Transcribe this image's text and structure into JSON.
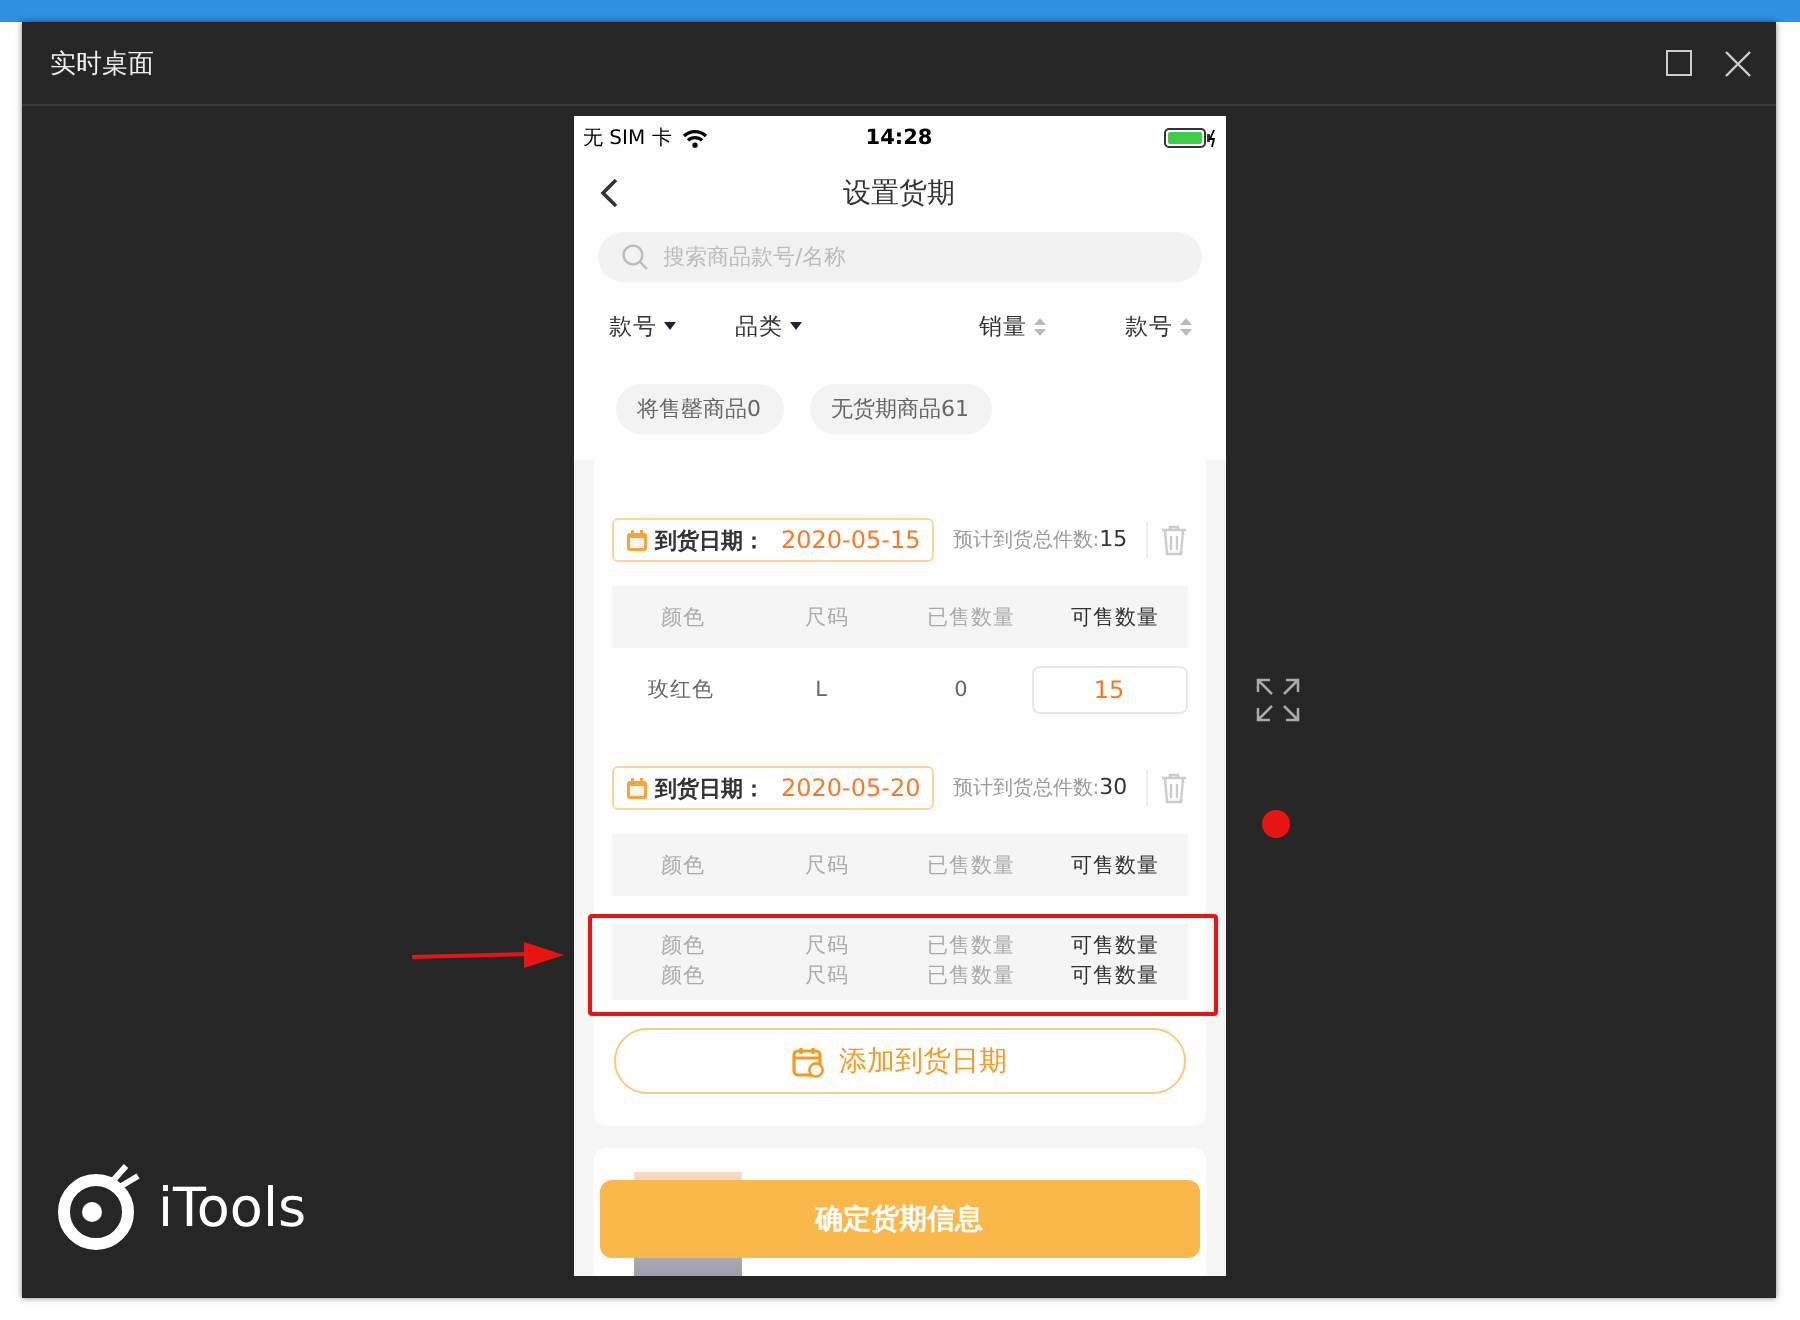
{
  "window": {
    "title": "实时桌面"
  },
  "phone": {
    "status_bar": {
      "carrier": "无 SIM 卡",
      "time": "14:28"
    },
    "nav": {
      "title": "设置货期"
    },
    "search": {
      "placeholder": "搜索商品款号/名称"
    },
    "filters": [
      {
        "label": "款号",
        "kind": "dropdown"
      },
      {
        "label": "品类",
        "kind": "dropdown"
      },
      {
        "label": "销量",
        "kind": "sort"
      },
      {
        "label": "款号",
        "kind": "sort"
      }
    ],
    "chips": [
      "将售罄商品0",
      "无货期商品61"
    ],
    "batches": [
      {
        "date_label": "到货日期：",
        "date": "2020-05-15",
        "total_label": "预计到货总件数:",
        "total": "15",
        "columns": [
          "颜色",
          "尺码",
          "已售数量",
          "可售数量"
        ],
        "rows": [
          [
            "玫红色",
            "L",
            "0",
            "15"
          ]
        ]
      },
      {
        "date_label": "到货日期：",
        "date": "2020-05-20",
        "total_label": "预计到货总件数:",
        "total": "30",
        "columns": [
          "颜色",
          "尺码",
          "已售数量",
          "可售数量"
        ]
      }
    ],
    "overlapping_headers": [
      [
        "颜色",
        "尺码",
        "已售数量",
        "可售数量"
      ],
      [
        "颜色",
        "尺码",
        "已售数量",
        "可售数量"
      ]
    ],
    "add_button": "添加到货日期",
    "confirm_button": "确定货期信息"
  },
  "logo": {
    "text": "iTools"
  }
}
